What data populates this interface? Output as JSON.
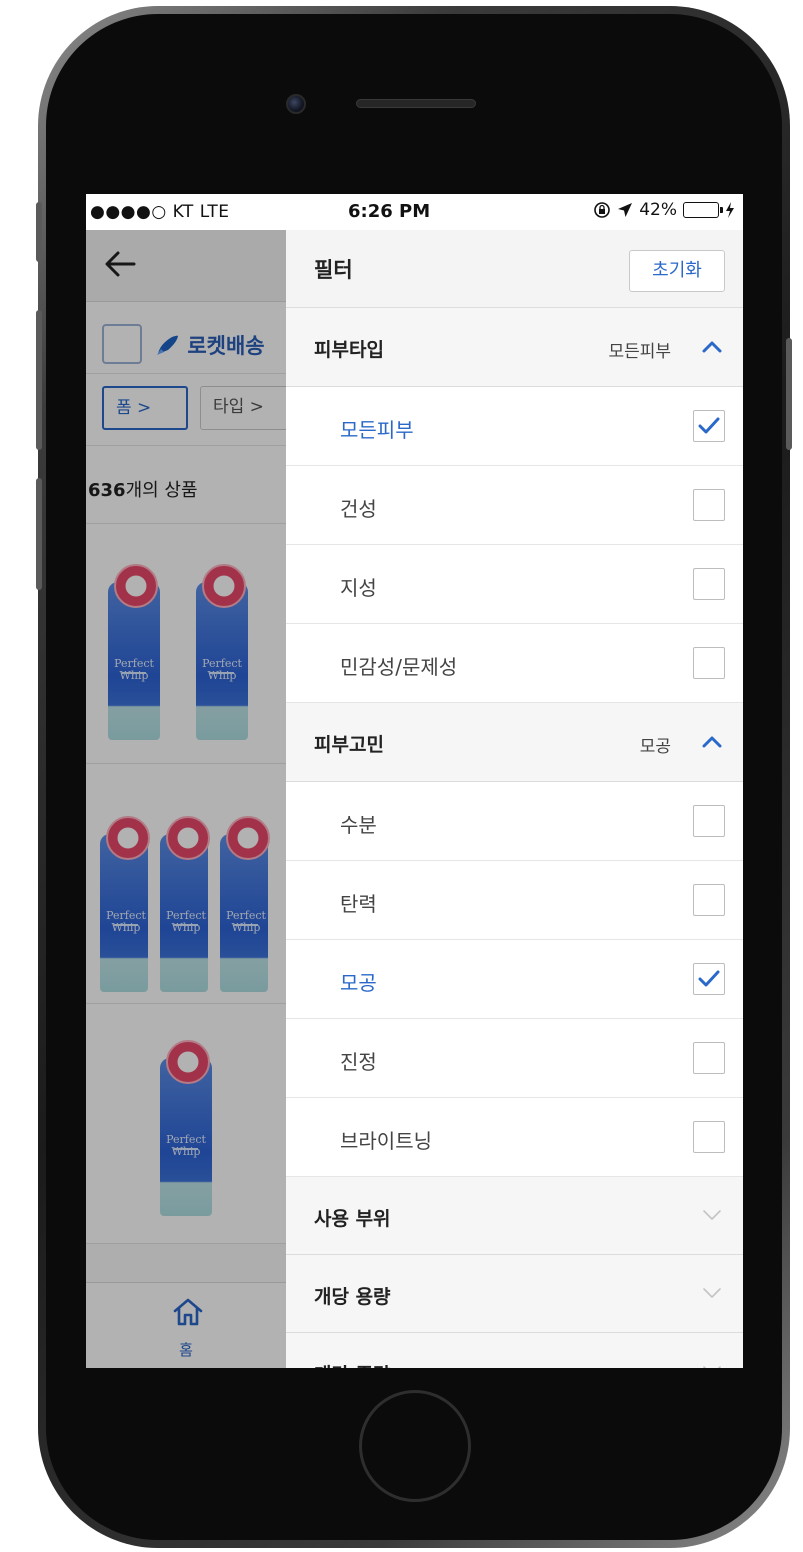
{
  "status_bar": {
    "carrier": "●●●●○ KT  LTE",
    "time": "6:26 PM",
    "icons": [
      "rotation-lock-icon",
      "location-arrow-icon"
    ],
    "battery_percent": "42%",
    "battery_level": 0.42
  },
  "background_page": {
    "back_icon": "back-arrow-icon",
    "rocket_delivery_label": "로켓배송",
    "rocket_delivery_checked": false,
    "chips": [
      {
        "label": "폼  >"
      },
      {
        "label": "타입 >"
      }
    ],
    "product_count_number": "636",
    "product_count_suffix": "개의 상품",
    "products": [
      {
        "tube_text": "Perfect Whip",
        "tubes": 2
      },
      {
        "tube_text": "Perfect Whip",
        "tubes": 3
      },
      {
        "tube_text": "Perfect Whip",
        "tubes": 1
      }
    ],
    "nav_home_label": "홈"
  },
  "filter_panel": {
    "title": "필터",
    "reset_label": "초기화",
    "sections": [
      {
        "title": "피부타입",
        "summary": "모든피부",
        "expanded": true,
        "options": [
          {
            "label": "모든피부",
            "checked": true
          },
          {
            "label": "건성",
            "checked": false
          },
          {
            "label": "지성",
            "checked": false
          },
          {
            "label": "민감성/문제성",
            "checked": false
          }
        ]
      },
      {
        "title": "피부고민",
        "summary": "모공",
        "expanded": true,
        "options": [
          {
            "label": "수분",
            "checked": false
          },
          {
            "label": "탄력",
            "checked": false
          },
          {
            "label": "모공",
            "checked": true
          },
          {
            "label": "진정",
            "checked": false
          },
          {
            "label": "브라이트닝",
            "checked": false
          }
        ]
      },
      {
        "title": "사용 부위",
        "expanded": false
      },
      {
        "title": "개당 용량",
        "expanded": false
      },
      {
        "title": "개당 중량",
        "expanded": false
      }
    ]
  },
  "colors": {
    "accent": "#2a68c9",
    "battery": "#4cd964"
  }
}
